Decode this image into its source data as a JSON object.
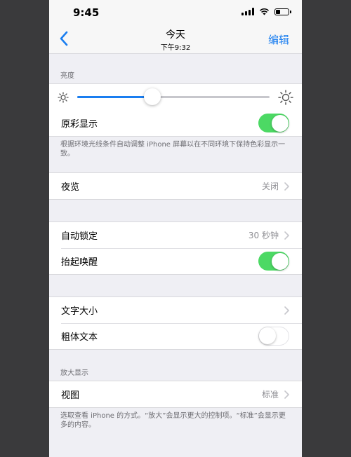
{
  "status_bar": {
    "time": "9:45"
  },
  "nav": {
    "title": "今天",
    "subtitle": "下午9:32",
    "edit_label": "编辑"
  },
  "brightness": {
    "header": "亮度",
    "level": 0.39
  },
  "true_tone": {
    "label": "原彩显示",
    "on": true,
    "note": "根据环境光线条件自动调整 iPhone 屏幕以在不同环境下保持色彩显示一致。"
  },
  "night_shift": {
    "label": "夜览",
    "value": "关闭"
  },
  "auto_lock": {
    "label": "自动锁定",
    "value": "30 秒钟"
  },
  "raise_to_wake": {
    "label": "抬起唤醒",
    "on": true
  },
  "text_size": {
    "label": "文字大小"
  },
  "bold_text": {
    "label": "粗体文本",
    "on": false
  },
  "zoom": {
    "header": "放大显示",
    "view_label": "视图",
    "view_value": "标准",
    "note": "选取查看 iPhone 的方式。“放大”会显示更大的控制项。“标准”会显示更多的内容。"
  },
  "colors": {
    "accent": "#1a7ef0",
    "toggle_on": "#4cd964",
    "background": "#efeff4",
    "secondary_text": "#8e8e93"
  }
}
